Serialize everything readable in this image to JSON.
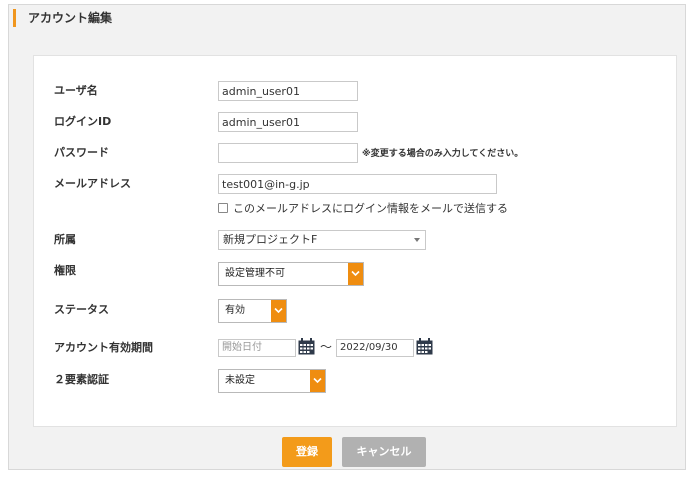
{
  "panel": {
    "title": "アカウント編集"
  },
  "form": {
    "username": {
      "label": "ユーザ名",
      "value": "admin_user01"
    },
    "login_id": {
      "label": "ログインID",
      "value": "admin_user01"
    },
    "password": {
      "label": "パスワード",
      "value": "",
      "hint": "※変更する場合のみ入力してください。"
    },
    "email": {
      "label": "メールアドレス",
      "value": "test001@in-g.jp",
      "send_checkbox_label": "このメールアドレスにログイン情報をメールで送信する",
      "send_checked": false
    },
    "affiliation": {
      "label": "所属",
      "selected": "新規プロジェクトF"
    },
    "permission": {
      "label": "権限",
      "selected": "設定管理不可"
    },
    "status": {
      "label": "ステータス",
      "selected": "有効"
    },
    "validity_period": {
      "label": "アカウント有効期間",
      "start_placeholder": "開始日付",
      "separator": "〜",
      "end_value": "2022/09/30"
    },
    "two_factor": {
      "label": "２要素認証",
      "selected": "未設定"
    }
  },
  "actions": {
    "submit_label": "登録",
    "cancel_label": "キャンセル"
  },
  "colors": {
    "accent": "#f0961e",
    "button_primary": "#f39b1a",
    "button_secondary": "#b1b1b1",
    "select_button": "#ef8d10"
  },
  "icons": {
    "calendar": "calendar-icon",
    "dropdown": "chevron-down-icon"
  }
}
